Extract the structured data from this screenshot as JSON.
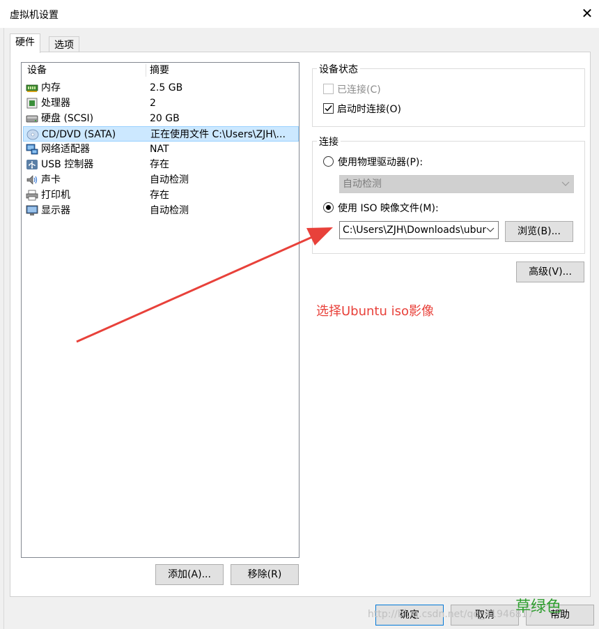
{
  "window": {
    "title": "虚拟机设置",
    "close_glyph": "✕"
  },
  "tabs": [
    {
      "label": "硬件"
    },
    {
      "label": "选项"
    }
  ],
  "device_list": {
    "col_device": "设备",
    "col_summary": "摘要",
    "rows": [
      {
        "name": "内存",
        "summary": "2.5 GB",
        "icon": "memory-icon"
      },
      {
        "name": "处理器",
        "summary": "2",
        "icon": "processor-icon"
      },
      {
        "name": "硬盘 (SCSI)",
        "summary": "20 GB",
        "icon": "hard-disk-icon"
      },
      {
        "name": "CD/DVD (SATA)",
        "summary": "正在使用文件 C:\\Users\\ZJH\\...",
        "icon": "cd-dvd-icon",
        "selected": true
      },
      {
        "name": "网络适配器",
        "summary": "NAT",
        "icon": "network-adapter-icon"
      },
      {
        "name": "USB 控制器",
        "summary": "存在",
        "icon": "usb-icon"
      },
      {
        "name": "声卡",
        "summary": "自动检测",
        "icon": "sound-card-icon"
      },
      {
        "name": "打印机",
        "summary": "存在",
        "icon": "printer-icon"
      },
      {
        "name": "显示器",
        "summary": "自动检测",
        "icon": "display-icon"
      }
    ]
  },
  "buttons": {
    "add": "添加(A)...",
    "remove": "移除(R)",
    "browse": "浏览(B)...",
    "advanced": "高级(V)...",
    "ok": "确定",
    "cancel": "取消",
    "help": "帮助"
  },
  "device_status": {
    "title": "设备状态",
    "connected_label": "已连接(C)",
    "connected_checked": false,
    "connect_at_power_on_label": "启动时连接(O)",
    "connect_at_power_on_checked": true
  },
  "connection": {
    "title": "连接",
    "physical_drive_label": "使用物理驱动器(P):",
    "physical_drive_value": "自动检测",
    "iso_label": "使用 ISO 映像文件(M):",
    "iso_path": "C:\\Users\\ZJH\\Downloads\\ubun",
    "selected_option": "iso"
  },
  "annotation": {
    "text": "选择Ubuntu iso影像",
    "color": "#e8413a"
  },
  "watermark": {
    "url_text": "http://blog.csdn.net/qq_41946817",
    "brand_text": "草绿色"
  },
  "colors": {
    "selection": "#cce8ff",
    "accent": "#0078d7",
    "arrow": "#e8413a"
  }
}
